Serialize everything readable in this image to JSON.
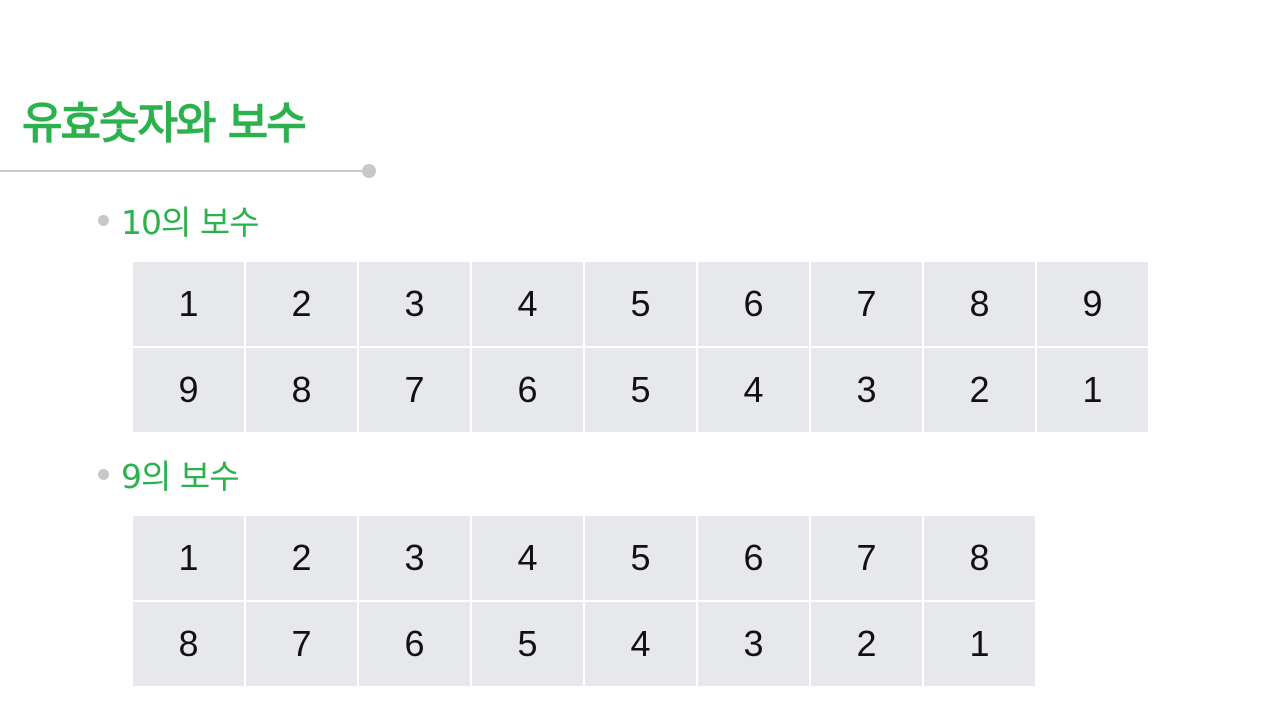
{
  "title": "유효숫자와 보수",
  "sections": [
    {
      "heading": "10의 보수",
      "rows": [
        [
          "1",
          "2",
          "3",
          "4",
          "5",
          "6",
          "7",
          "8",
          "9"
        ],
        [
          "9",
          "8",
          "7",
          "6",
          "5",
          "4",
          "3",
          "2",
          "1"
        ]
      ]
    },
    {
      "heading": "9의 보수",
      "rows": [
        [
          "1",
          "2",
          "3",
          "4",
          "5",
          "6",
          "7",
          "8"
        ],
        [
          "8",
          "7",
          "6",
          "5",
          "4",
          "3",
          "2",
          "1"
        ]
      ]
    }
  ],
  "colors": {
    "accent_green": "#2bb24c",
    "cell_background": "#e6e8eb",
    "rule_gray": "#c8c8c8",
    "text": "#111111"
  }
}
